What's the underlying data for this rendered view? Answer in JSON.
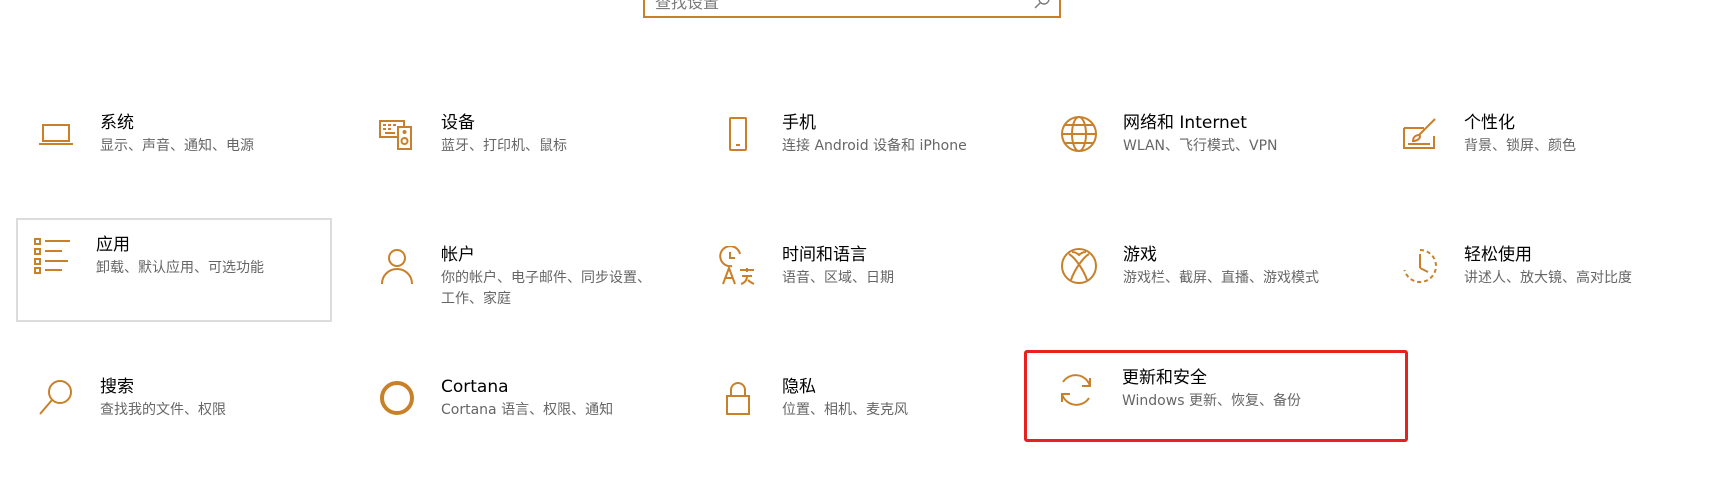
{
  "search": {
    "placeholder": "查找设置"
  },
  "accent_color": "#c8812a",
  "highlight_color": "#e8201f",
  "tiles": [
    {
      "id": "system",
      "icon": "laptop-icon",
      "title": "系统",
      "subtitle": "显示、声音、通知、电源"
    },
    {
      "id": "devices",
      "icon": "keyboard-speaker-icon",
      "title": "设备",
      "subtitle": "蓝牙、打印机、鼠标"
    },
    {
      "id": "phone",
      "icon": "phone-icon",
      "title": "手机",
      "subtitle": "连接 Android 设备和 iPhone"
    },
    {
      "id": "network",
      "icon": "globe-icon",
      "title": "网络和 Internet",
      "subtitle": "WLAN、飞行模式、VPN"
    },
    {
      "id": "personalization",
      "icon": "paint-brush-icon",
      "title": "个性化",
      "subtitle": "背景、锁屏、颜色"
    },
    {
      "id": "apps",
      "icon": "apps-list-icon",
      "title": "应用",
      "subtitle": "卸载、默认应用、可选功能"
    },
    {
      "id": "accounts",
      "icon": "person-icon",
      "title": "帐户",
      "subtitle": "你的帐户、电子邮件、同步设置、工作、家庭"
    },
    {
      "id": "time-language",
      "icon": "time-language-icon",
      "title": "时间和语言",
      "subtitle": "语音、区域、日期"
    },
    {
      "id": "gaming",
      "icon": "xbox-icon",
      "title": "游戏",
      "subtitle": "游戏栏、截屏、直播、游戏模式"
    },
    {
      "id": "ease-of-access",
      "icon": "ease-of-access-icon",
      "title": "轻松使用",
      "subtitle": "讲述人、放大镜、高对比度"
    },
    {
      "id": "search",
      "icon": "magnifier-icon",
      "title": "搜索",
      "subtitle": "查找我的文件、权限"
    },
    {
      "id": "cortana",
      "icon": "cortana-ring-icon",
      "title": "Cortana",
      "subtitle": "Cortana 语言、权限、通知"
    },
    {
      "id": "privacy",
      "icon": "lock-icon",
      "title": "隐私",
      "subtitle": "位置、相机、麦克风"
    },
    {
      "id": "update-security",
      "icon": "sync-arrows-icon",
      "title": "更新和安全",
      "subtitle": "Windows 更新、恢复、备份"
    }
  ]
}
